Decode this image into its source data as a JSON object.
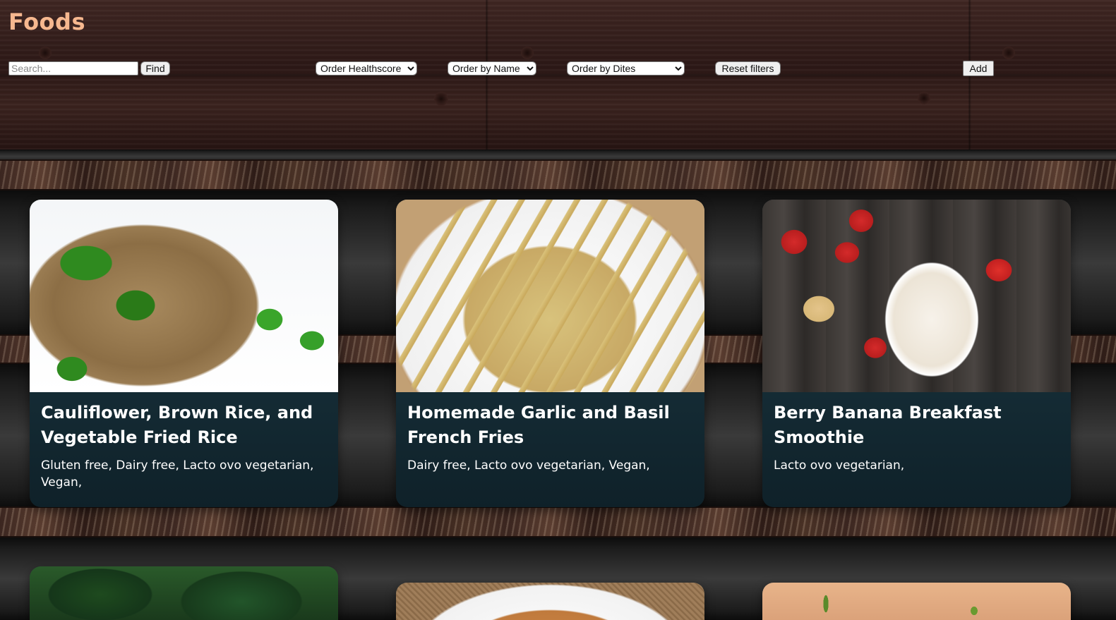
{
  "header": {
    "title": "Foods",
    "search": {
      "placeholder": "Search...",
      "value": ""
    },
    "find_label": "Find",
    "filters": {
      "healthscore": {
        "selected": "Order Healthscore"
      },
      "name": {
        "selected": "Order by Name"
      },
      "diets": {
        "selected": "Order by Dites"
      }
    },
    "reset_label": "Reset filters",
    "add_label": "Add"
  },
  "recipes": [
    {
      "title": "Cauliflower, Brown Rice, and Vegetable Fried Rice",
      "diets": "Gluten free, Dairy free, Lacto ovo vegetarian, Vegan,"
    },
    {
      "title": "Homemade Garlic and Basil French Fries",
      "diets": "Dairy free, Lacto ovo vegetarian, Vegan,"
    },
    {
      "title": "Berry Banana Breakfast Smoothie",
      "diets": "Lacto ovo vegetarian,"
    }
  ],
  "colors": {
    "title": "#f6b88f",
    "card_background": "#1b3540",
    "card_text": "#ffffff"
  }
}
